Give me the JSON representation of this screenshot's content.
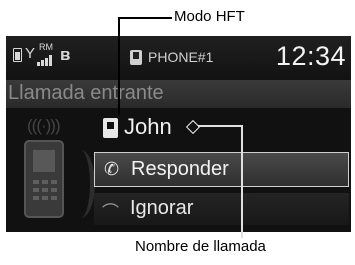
{
  "annotations": {
    "mode_label": "Modo HFT",
    "caller_label": "Nombre de llamada"
  },
  "status_bar": {
    "roam_indicator": "RM",
    "phone_name": "PHONE#1",
    "clock": "12:34",
    "icons": [
      "battery-icon",
      "antenna-icon",
      "signal-strength-icon",
      "bluetooth-icon",
      "phone-profile-icon"
    ]
  },
  "call": {
    "status_text": "Llamada entrante",
    "caller_name": "John",
    "caller_icon": "contact-card-icon"
  },
  "options": [
    {
      "label": "Responder",
      "icon": "answer-call-icon",
      "selected": true
    },
    {
      "label": "Ignorar",
      "icon": "hang-up-icon",
      "selected": false
    }
  ],
  "colors": {
    "screen_bg": "#111111",
    "selection_border": "#cfcfcf",
    "text_primary": "#f0f0f0",
    "text_dim": "#8a8a8a"
  }
}
